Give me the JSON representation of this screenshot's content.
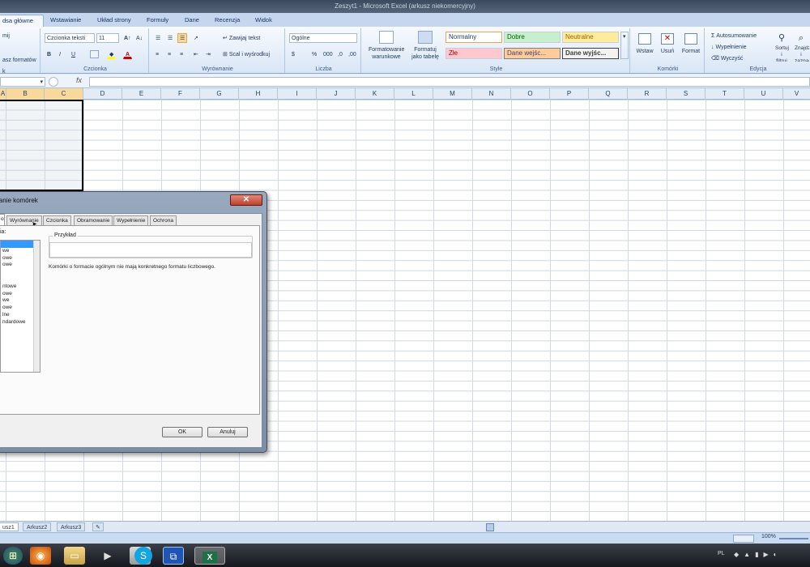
{
  "title": "Zeszyt1 - Microsoft Excel (arkusz niekomercyjny)",
  "ribbon_tabs": [
    "dsa główne",
    "Wstawianie",
    "Układ strony",
    "Formuły",
    "Dane",
    "Recenzja",
    "Widok"
  ],
  "clipboard": {
    "item1": "mij",
    "item2": "asz formatów",
    "item3": "k"
  },
  "font": {
    "name": "Czcionka teksti",
    "size": "11",
    "label": "Czcionka"
  },
  "alignment": {
    "wrap": "Zawijaj tekst",
    "merge": "Scal i wyśrodkuj",
    "label": "Wyrównanie"
  },
  "number": {
    "format": "Ogólne",
    "label": "Liczba"
  },
  "styles": {
    "cond_format": "Formatowanie warunkowe",
    "as_table": "Formatuj jako tabelę",
    "cells": [
      "Normalny",
      "Dobre",
      "Neutralne",
      "Złe",
      "Dane wejśc...",
      "Dane wyjśc..."
    ],
    "label": "Style"
  },
  "cells_group": {
    "insert": "Wstaw",
    "delete": "Usuń",
    "format": "Format",
    "label": "Komórki"
  },
  "editing": {
    "autosum": "Autosumowanie",
    "fill": "Wypełnienie",
    "clear": "Wyczyść",
    "sort": "Sortuj i filtruj",
    "find": "Znajdź i zaznacz",
    "label": "Edycja"
  },
  "formula_bar": {
    "fx": "fx"
  },
  "columns": [
    "A",
    "B",
    "C",
    "D",
    "E",
    "F",
    "G",
    "H",
    "I",
    "J",
    "K",
    "L",
    "M",
    "N",
    "O",
    "P",
    "Q",
    "R",
    "S",
    "T",
    "U",
    "V"
  ],
  "sheets": [
    "usz1",
    "Arkusz2",
    "Arkusz3"
  ],
  "zoom": "100%",
  "dialog": {
    "title": "ianie komórek",
    "tabs": [
      "o",
      "Wyrównanie",
      "Czcionka",
      "Obramowanie",
      "Wypełnienie",
      "Ochrona"
    ],
    "category_label": "ia:",
    "categories": [
      "",
      "we",
      "owe",
      "owe",
      "",
      "",
      "ntowe",
      "owe",
      "we",
      "owe",
      "lne",
      "ndardowe"
    ],
    "example_label": "Przykład",
    "description": "Komórki o formacie ogólnym nie mają konkretnego formatu liczbowego.",
    "ok": "OK",
    "cancel": "Anuluj"
  },
  "taskbar": {
    "lang": "PL"
  },
  "colors": {
    "accent": "#f9d99b",
    "ribbon": "#dfe8f4",
    "good": "#c6efce",
    "neutral": "#ffeb9c",
    "bad": "#ffc7ce"
  }
}
